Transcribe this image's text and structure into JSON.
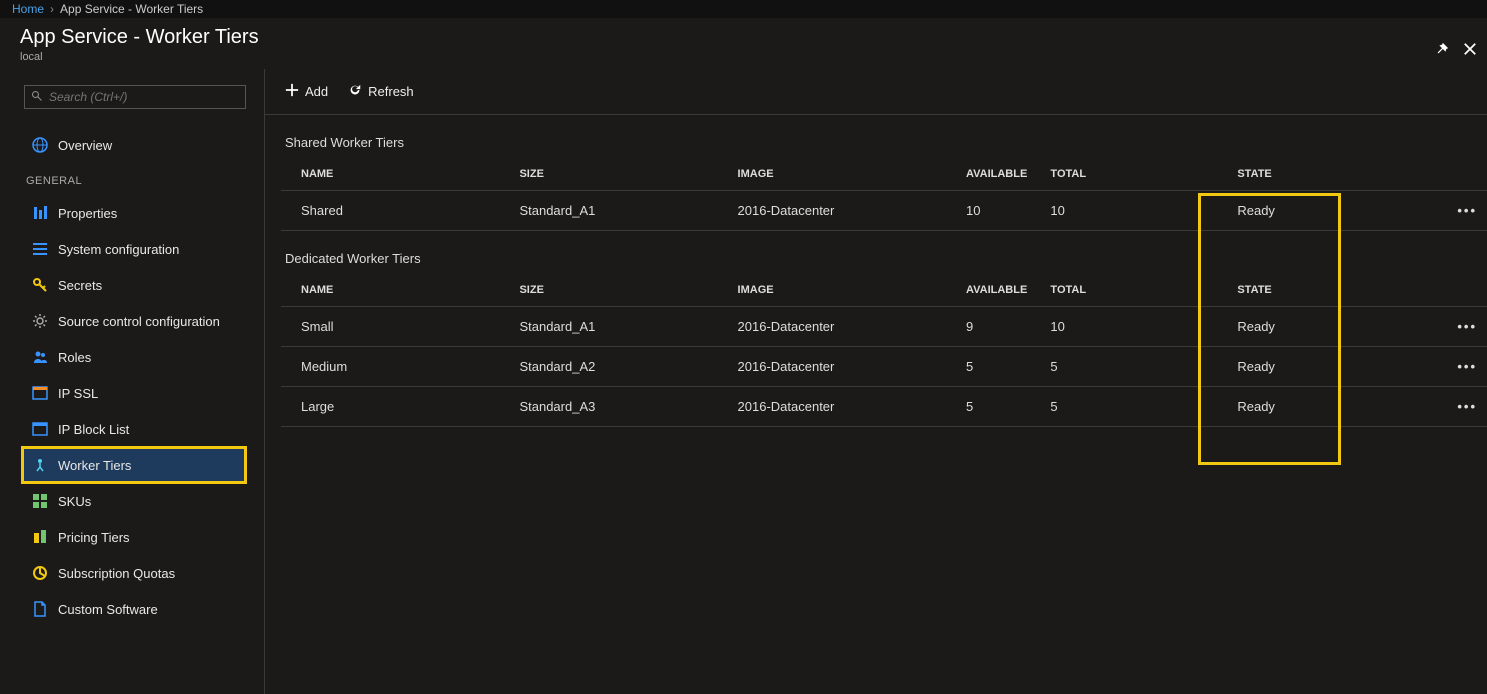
{
  "breadcrumb": {
    "home": "Home",
    "current": "App Service - Worker Tiers"
  },
  "header": {
    "title": "App Service - Worker Tiers",
    "subtitle": "local"
  },
  "sidebar": {
    "search_placeholder": "Search (Ctrl+/)",
    "overview": "Overview",
    "section_general": "GENERAL",
    "items": {
      "properties": "Properties",
      "system_configuration": "System configuration",
      "secrets": "Secrets",
      "source_control": "Source control configuration",
      "roles": "Roles",
      "ip_ssl": "IP SSL",
      "ip_block": "IP Block List",
      "worker_tiers": "Worker Tiers",
      "skus": "SKUs",
      "pricing_tiers": "Pricing Tiers",
      "subscription_quotas": "Subscription Quotas",
      "custom_software": "Custom Software"
    }
  },
  "toolbar": {
    "add": "Add",
    "refresh": "Refresh"
  },
  "tables": {
    "shared": {
      "title": "Shared Worker Tiers",
      "headers": {
        "name": "NAME",
        "size": "SIZE",
        "image": "IMAGE",
        "available": "AVAILABLE",
        "total": "TOTAL",
        "state": "STATE"
      },
      "rows": [
        {
          "name": "Shared",
          "size": "Standard_A1",
          "image": "2016-Datacenter",
          "available": "10",
          "total": "10",
          "state": "Ready"
        }
      ]
    },
    "dedicated": {
      "title": "Dedicated Worker Tiers",
      "headers": {
        "name": "NAME",
        "size": "SIZE",
        "image": "IMAGE",
        "available": "AVAILABLE",
        "total": "TOTAL",
        "state": "STATE"
      },
      "rows": [
        {
          "name": "Small",
          "size": "Standard_A1",
          "image": "2016-Datacenter",
          "available": "9",
          "total": "10",
          "state": "Ready"
        },
        {
          "name": "Medium",
          "size": "Standard_A2",
          "image": "2016-Datacenter",
          "available": "5",
          "total": "5",
          "state": "Ready"
        },
        {
          "name": "Large",
          "size": "Standard_A3",
          "image": "2016-Datacenter",
          "available": "5",
          "total": "5",
          "state": "Ready"
        }
      ]
    }
  }
}
